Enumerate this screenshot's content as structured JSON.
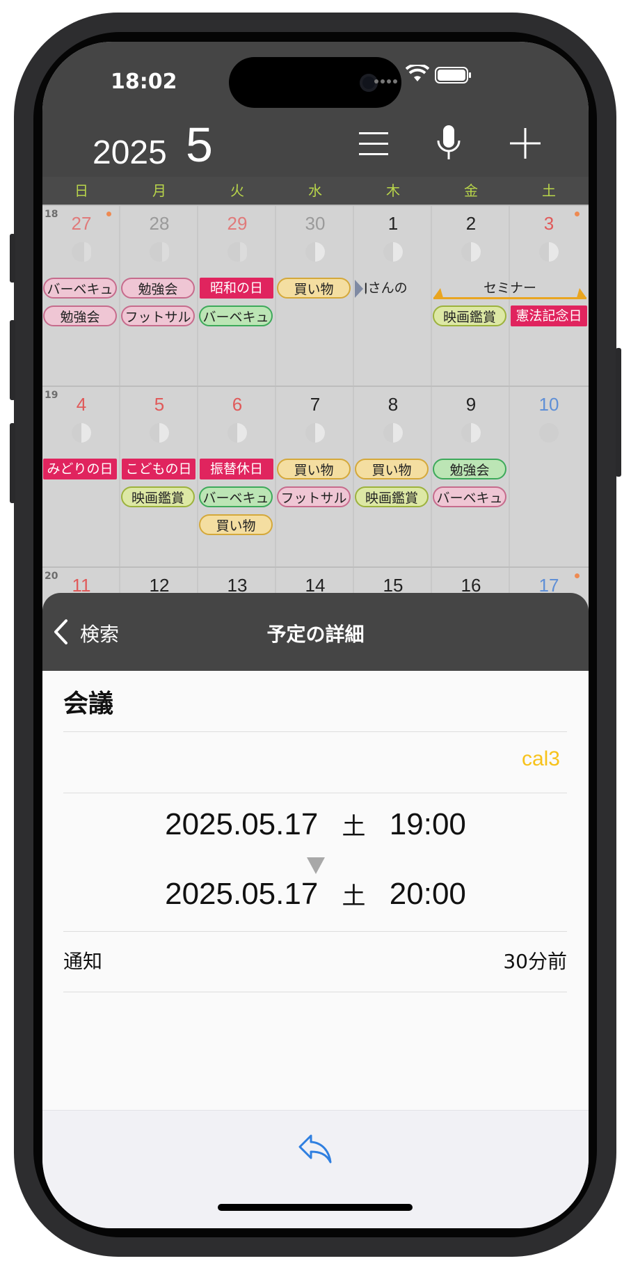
{
  "status": {
    "time": "18:02"
  },
  "header": {
    "year": "2025",
    "month": "5",
    "menu_icon": "menu-icon",
    "mic_icon": "microphone-icon",
    "add_icon": "plus-icon"
  },
  "weekdays": [
    "日",
    "月",
    "火",
    "水",
    "木",
    "金",
    "土"
  ],
  "weeks": [
    {
      "weeknum": "18",
      "days": [
        "27",
        "28",
        "29",
        "30",
        "1",
        "2",
        "3"
      ],
      "events": {
        "sun": [
          "バーベキュ",
          "勉強会"
        ],
        "mon": [
          "勉強会",
          "フットサル"
        ],
        "tue": [
          "昭和の日",
          "バーベキュ"
        ],
        "wed": [
          "買い物"
        ],
        "thu": [
          "Jさんの"
        ],
        "fri_sat_span": "セミナー",
        "fri": [
          "映画鑑賞"
        ],
        "sat": [
          "憲法記念日"
        ]
      }
    },
    {
      "weeknum": "19",
      "days": [
        "4",
        "5",
        "6",
        "7",
        "8",
        "9",
        "10"
      ],
      "events": {
        "sun": [
          "みどりの日"
        ],
        "mon": [
          "こどもの日",
          "映画鑑賞"
        ],
        "tue": [
          "振替休日",
          "バーベキュ",
          "買い物"
        ],
        "wed": [
          "買い物",
          "フットサル"
        ],
        "thu": [
          "買い物",
          "映画鑑賞"
        ],
        "fri": [
          "勉強会",
          "バーベキュ"
        ],
        "sat": []
      }
    },
    {
      "weeknum": "20",
      "days": [
        "11",
        "12",
        "13",
        "14",
        "15",
        "16",
        "17"
      ]
    }
  ],
  "panel": {
    "back_label": "検索",
    "title": "予定の詳細",
    "event_title": "会議",
    "calendar": "cal3",
    "start": {
      "date": "2025.05.17",
      "weekday": "土",
      "time": "19:00"
    },
    "end": {
      "date": "2025.05.17",
      "weekday": "土",
      "time": "20:00"
    },
    "notification_label": "通知",
    "notification_value": "30分前",
    "reply_icon": "reply-icon"
  },
  "colors": {
    "sunday": "#e05a5a",
    "saturday_blue": "#5f8fd6",
    "calendar_accent": "#f7c21a",
    "reply_blue": "#2f7fe0"
  }
}
